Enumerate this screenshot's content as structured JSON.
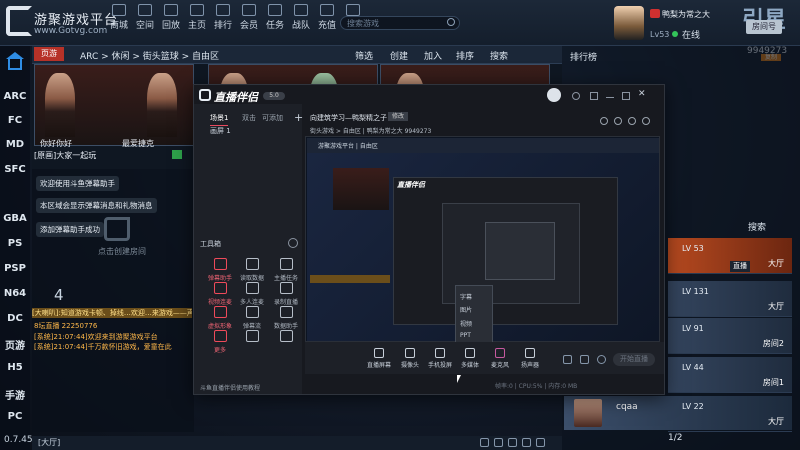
{
  "header": {
    "app_title": "游聚游戏平台",
    "app_url": "www.Gotvg.com",
    "nav": [
      "商城",
      "空间",
      "回放",
      "主页",
      "排行",
      "会员",
      "任务",
      "战队",
      "充值",
      "邮件"
    ],
    "search_placeholder": "搜索游戏",
    "user_name": "鸭梨为常之大",
    "user_level": "Lv53",
    "online_status": "在线",
    "right_logo": "引星",
    "right_logo_btn": "房间号",
    "room_number": "9949273",
    "room_number_badge": "复制"
  },
  "left_nav": {
    "items": [
      "ARC",
      "FC",
      "MD",
      "SFC",
      "GBA",
      "PS",
      "PSP",
      "N64",
      "DC",
      "页游",
      "H5",
      "手游",
      "PC"
    ],
    "version": "0.7.45"
  },
  "breadcrumb": {
    "tab": "页游",
    "path": "ARC > 休闲 > 街头篮球 > 自由区",
    "actions": [
      "筛选",
      "创建",
      "加入",
      "排序",
      "搜索"
    ]
  },
  "rooms": {
    "room1_title": "[原画]大家一起玩",
    "room1_name1": "你好你好",
    "room1_name2": "最爱捷克"
  },
  "chat": {
    "system_messages": [
      "欢迎使用斗鱼弹幕助手",
      "本区域会显示弹幕消息和礼物消息",
      "添加弹幕助手成功"
    ],
    "create_room": "点击创建房间",
    "count": "4",
    "marquee": "[大喇叭]:知道游戏卡顿、掉线…欢迎…来游戏——声音直播",
    "lines": [
      {
        "text": "8坛直播 22250776",
        "color": "#ffb84a"
      },
      {
        "text": "[系统]21:07:44]欢迎来到游聚游戏平台",
        "color": "#ffb84a"
      },
      {
        "text": "[系统]21:07:44]千万款怀旧游戏，爱童在此",
        "color": "#ffb84a"
      }
    ],
    "status_tag": "[大厅]"
  },
  "right_panel": {
    "rank_label": "排行榜",
    "search": "搜索",
    "players": [
      {
        "level": "LV 53",
        "role": "大厅",
        "active": true,
        "btn": "直播"
      },
      {
        "level": "LV 131",
        "role": "大厅",
        "active": false
      },
      {
        "level": "LV 91",
        "role": "房间2",
        "active": false
      },
      {
        "level": "LV 44",
        "role": "房间1",
        "active": false
      },
      {
        "level": "LV 22",
        "role": "大厅",
        "active": false
      }
    ],
    "current_user": "cqaa",
    "pager": "1/2"
  },
  "overlay": {
    "title": "直播伴侣",
    "title_badge": "5.0",
    "tabs": [
      "场景1",
      "双击",
      "可添加"
    ],
    "scene_item": "画屏 1",
    "tools_label": "工具箱",
    "tools": [
      {
        "label": "弹幕助手",
        "hot": true
      },
      {
        "label": "读取数据",
        "hot": false
      },
      {
        "label": "主播任务",
        "hot": false
      },
      {
        "label": "视频连麦",
        "hot": true
      },
      {
        "label": "多人连麦",
        "hot": false
      },
      {
        "label": "录制直播",
        "hot": false
      },
      {
        "label": "虚拟形象",
        "hot": true
      },
      {
        "label": "弹幕流",
        "hot": false
      },
      {
        "label": "数据助手",
        "hot": false
      },
      {
        "label": "更多",
        "hot": false
      },
      {
        "label": "",
        "hot": false
      },
      {
        "label": "",
        "hot": false
      }
    ],
    "footnote": "斗鱼直播伴侣使用教程",
    "stream_title": "向建筑学习—鸭梨精之子!",
    "stream_tag": "修改",
    "room_meta": "街头游戏 > 自由区 | 鸭梨为常之大 9949273",
    "preview_text": "游聚游戏平台 | 自由区",
    "nested_title": "直播伴侣",
    "popup": [
      "字幕",
      "图片",
      "视频",
      "PPT"
    ],
    "bottom_buttons": [
      "直播屏幕",
      "摄像头",
      "手机投屏",
      "多媒体",
      "麦克风",
      "扬声器"
    ],
    "go_live": "开始直播",
    "status": "帧率:0 | CPU:5% | 内存:0 MB"
  }
}
